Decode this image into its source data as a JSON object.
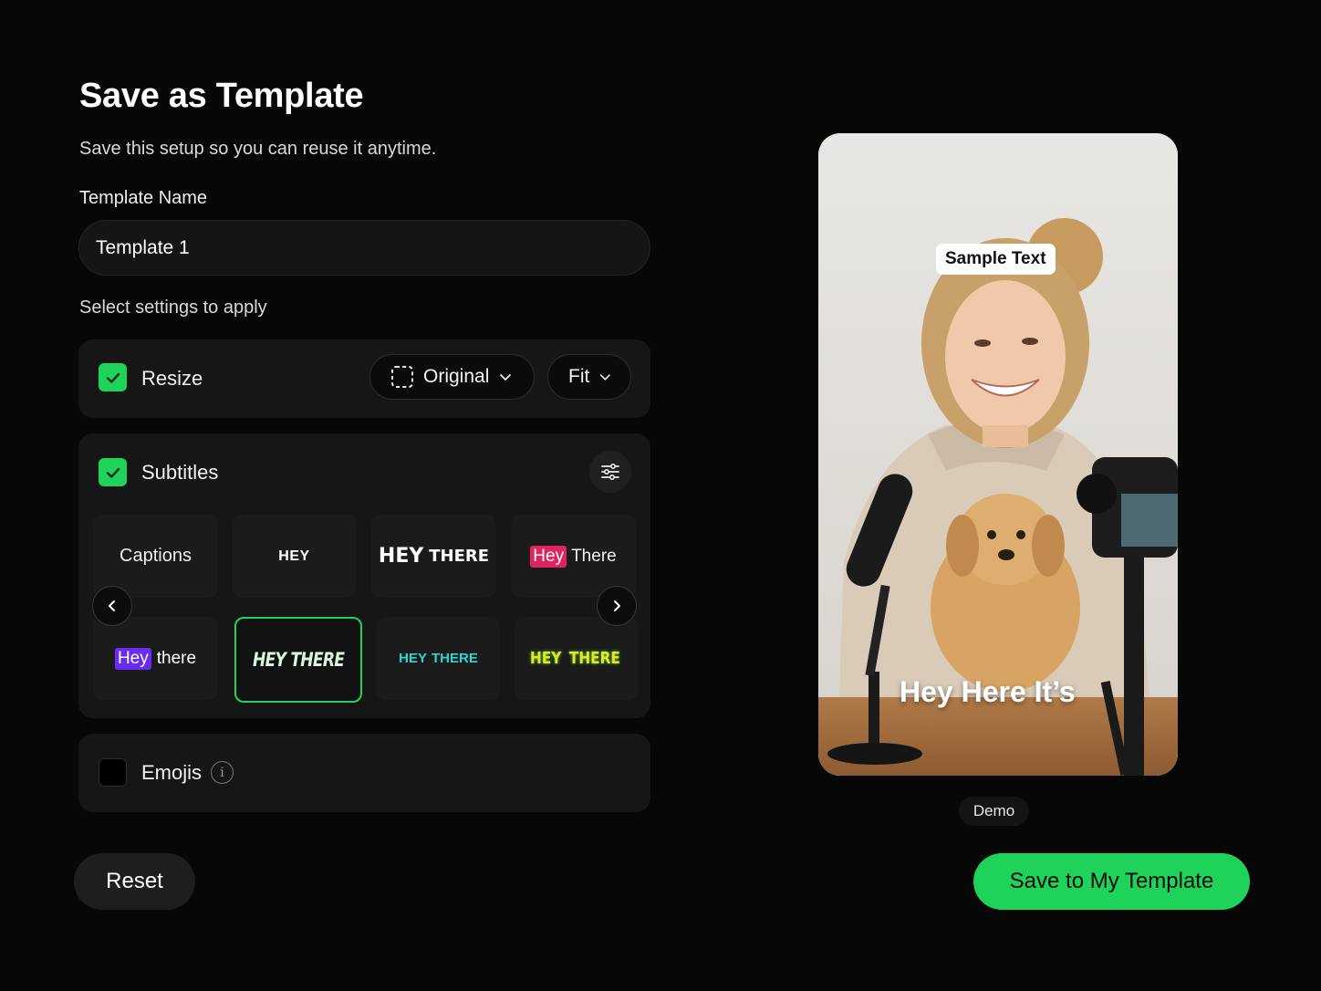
{
  "header": {
    "title": "Save as Template",
    "subtitle": "Save this setup so you can reuse it anytime."
  },
  "template_name": {
    "label": "Template Name",
    "value": "Template 1",
    "placeholder": ""
  },
  "settings": {
    "label": "Select settings to apply",
    "resize": {
      "label": "Resize",
      "checked": true,
      "aspect_value": "Original",
      "fit_value": "Fit"
    },
    "subtitles": {
      "label": "Subtitles",
      "checked": true,
      "styles": [
        {
          "label": "Captions"
        },
        {
          "label": "HEY"
        },
        {
          "label_a": "HEY",
          "label_b": "THERE"
        },
        {
          "label_a": "Hey",
          "label_b": "There"
        },
        {
          "label_a": "Hey",
          "label_b": "there"
        },
        {
          "label": "HEY THERE",
          "selected": true
        },
        {
          "label_a": "HEY",
          "label_b": "THERE"
        },
        {
          "label_a": "HEY",
          "label_b": "THERE"
        }
      ]
    },
    "emojis": {
      "label": "Emojis",
      "checked": false,
      "info_glyph": "i"
    }
  },
  "preview": {
    "sample_text": "Sample Text",
    "caption": "Hey Here It’s",
    "badge": "Demo"
  },
  "actions": {
    "reset_label": "Reset",
    "save_label": "Save to My Template"
  },
  "colors": {
    "accent": "#1fd25a",
    "background": "#070707",
    "card": "#161616"
  },
  "icons": [
    "check-icon",
    "crop-frame-icon",
    "chevron-down-icon",
    "sliders-icon",
    "chevron-left-icon",
    "chevron-right-icon",
    "info-icon"
  ]
}
